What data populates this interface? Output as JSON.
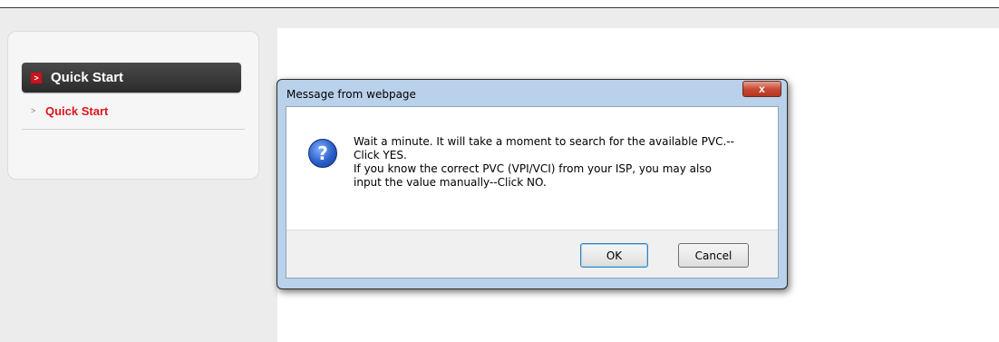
{
  "sidebar": {
    "header_label": "Quick Start",
    "items": [
      {
        "label": "Quick Start"
      }
    ]
  },
  "dialog": {
    "title": "Message from webpage",
    "close_label": "x",
    "message": "Wait a minute. It will take a moment to search for the available PVC.--\nClick YES.\nIf you know the correct PVC (VPI/VCI) from your ISP, you may also\ninput the value manually--Click NO.",
    "ok_label": "OK",
    "cancel_label": "Cancel",
    "icon": "question-icon"
  },
  "colors": {
    "accent": "#e0141e",
    "sidebar_header_bg": "#2b2b2b",
    "dialog_frame": "#b9d1ea"
  }
}
